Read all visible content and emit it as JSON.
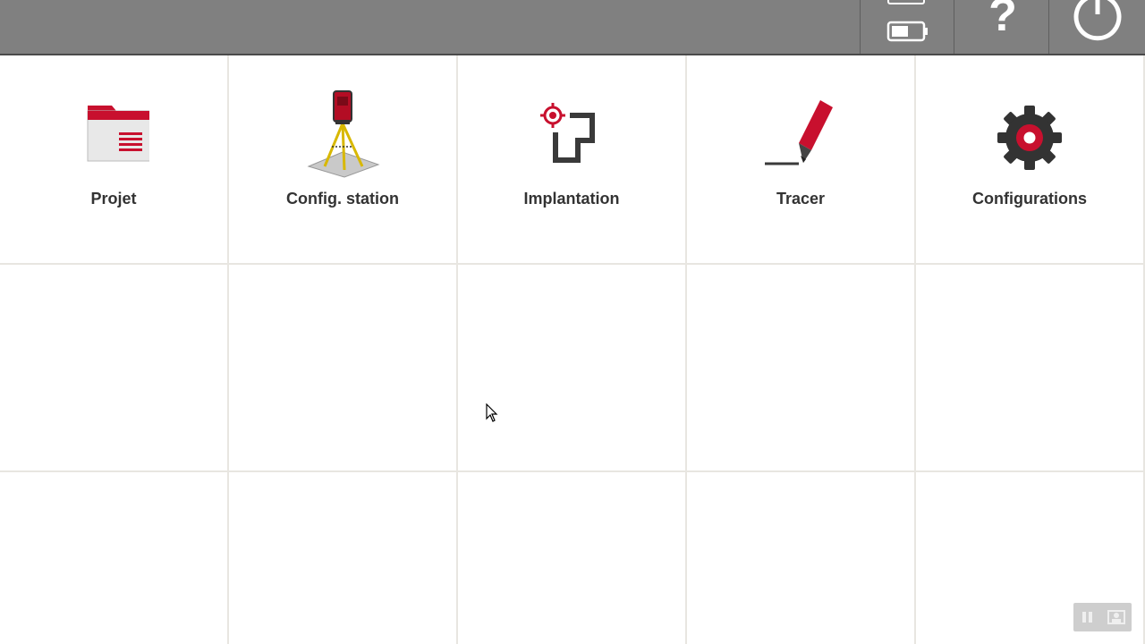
{
  "topbar": {
    "status_icons": [
      "storage-icon",
      "battery-icon"
    ],
    "help_icon": "question-mark-icon",
    "power_icon": "power-icon"
  },
  "tiles": [
    {
      "label": "Projet",
      "icon": "folder-icon"
    },
    {
      "label": "Config. station",
      "icon": "total-station-tripod-icon"
    },
    {
      "label": "Implantation",
      "icon": "stakeout-target-icon"
    },
    {
      "label": "Tracer",
      "icon": "pen-icon"
    },
    {
      "label": "Configurations",
      "icon": "gear-icon"
    }
  ],
  "colors": {
    "accent": "#c8102e",
    "topbar": "#808080",
    "icon_dark": "#3a3a3a"
  }
}
